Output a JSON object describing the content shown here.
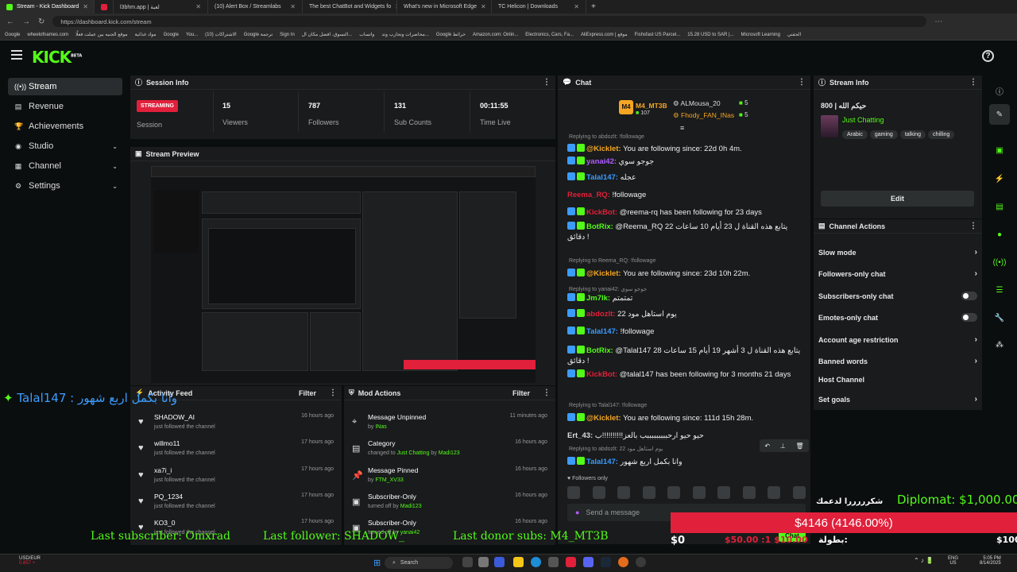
{
  "browser": {
    "tabs": [
      {
        "label": "Stream - Kick Dashboard",
        "active": true
      },
      {
        "label": ""
      },
      {
        "label": "l3bhm.app | لعبة"
      },
      {
        "label": "(10) Alert Box / Streamlabs"
      },
      {
        "label": "The best ChatBot and Widgets fo"
      },
      {
        "label": "What's new in Microsoft Edge"
      },
      {
        "label": "TC Helicon | Downloads"
      }
    ],
    "url": "https://dashboard.kick.com/stream",
    "bookmarks": [
      "Google",
      "wheelofnames.com",
      "موقع الجنيه بين عملت فعلًا",
      "مواد غذائية",
      "Google",
      "You...",
      "(10) الاشتراكات",
      "Google ترجمة",
      "Sign In",
      "التسوق، افضل مكان ال...",
      "واتساب",
      "محاضرات وتجارب وتد...",
      "Google خرائط",
      "Amazon.com: Onlin...",
      "Electronics, Cars, Fa...",
      "AliExpress.com | موقع",
      "Fishsfast US Parcel...",
      "15.28 USD to SAR |...",
      "Microsoft Learning",
      "الحقني"
    ]
  },
  "header": {
    "logo": "KICK",
    "logo_sup": "BETA"
  },
  "sidebar": [
    {
      "label": "Stream",
      "icon": "broadcast-icon",
      "active": true
    },
    {
      "label": "Revenue",
      "icon": "revenue-icon"
    },
    {
      "label": "Achievements",
      "icon": "trophy-icon"
    },
    {
      "label": "Studio",
      "icon": "studio-icon",
      "chevron": true
    },
    {
      "label": "Channel",
      "icon": "channel-icon",
      "chevron": true
    },
    {
      "label": "Settings",
      "icon": "gear-icon",
      "chevron": true
    }
  ],
  "session": {
    "title": "Session Info",
    "badge": "STREAMING",
    "badge_label": "Session",
    "stats": [
      {
        "value": "15",
        "label": "Viewers"
      },
      {
        "value": "787",
        "label": "Followers"
      },
      {
        "value": "131",
        "label": "Sub Counts"
      },
      {
        "value": "00:11:55",
        "label": "Time Live"
      }
    ]
  },
  "preview": {
    "title": "Stream Preview"
  },
  "activity": {
    "title": "Activity Feed",
    "filter": "Filter",
    "rows": [
      {
        "name": "SHADOW_AI",
        "desc": "just followed the channel",
        "time": "16 hours ago"
      },
      {
        "name": "willmo11",
        "desc": "just followed the channel",
        "time": "17 hours ago"
      },
      {
        "name": "xa7i_i",
        "desc": "just followed the channel",
        "time": "17 hours ago"
      },
      {
        "name": "PQ_1234",
        "desc": "just followed the channel",
        "time": "17 hours ago"
      },
      {
        "name": "KO3_0",
        "desc": "just followed the channel",
        "time": "17 hours ago"
      }
    ]
  },
  "mod": {
    "title": "Mod Actions",
    "filter": "Filter",
    "rows": [
      {
        "title": "Message Unpinned",
        "by": "by",
        "who": "INas",
        "time": "11 minutes ago",
        "icon": "unpin-icon"
      },
      {
        "title": "Category",
        "by": "changed to",
        "who": "Just Chatting",
        "by2": "by",
        "who2": "Madi123",
        "time": "16 hours ago",
        "icon": "category-icon"
      },
      {
        "title": "Message Pinned",
        "by": "by",
        "who": "FTM_XV33",
        "time": "16 hours ago",
        "icon": "pin-icon"
      },
      {
        "title": "Subscriber-Only",
        "by": "turned off by",
        "who": "Madi123",
        "time": "16 hours ago",
        "icon": "subscriber-icon"
      },
      {
        "title": "Subscriber-Only",
        "by": "turned off by",
        "who": "yanai42",
        "time": "16 hours ago",
        "icon": "subscriber-icon"
      }
    ]
  },
  "chat": {
    "title": "Chat",
    "top": [
      {
        "rank": "M4",
        "name": "M4_MT3B",
        "count": "107"
      },
      {
        "name": "ALMousa_20",
        "count": "5"
      },
      {
        "name": "Fhody_FAN_INas",
        "count": "5"
      }
    ],
    "messages": [
      {
        "reply": "Replying to abdozlt: !followage"
      },
      {
        "name": "@Kicklet:",
        "color": "#f5a623",
        "text": "You are following since: 22d 0h 4m."
      },
      {
        "name": "yanai42:",
        "color": "#b05cff",
        "text": "جوجو سوي"
      },
      {
        "name": "Talal147:",
        "color": "#3b9cff",
        "text": "عجله"
      },
      {
        "name": "Reema_RQ:",
        "color": "#e1203b",
        "text": "!followage"
      },
      {
        "name": "KickBot:",
        "color": "#e1203b",
        "text": "@reema-rq has been following for 23 days"
      },
      {
        "name": "BotRix:",
        "color": "#53fc18",
        "text": "@Reema_RQ يتابع هذه القناة ل 23 أيام 10 ساعات 22 دقائق !"
      },
      {
        "reply": "Replying to Reema_RQ: !followage"
      },
      {
        "name": "@Kicklet:",
        "color": "#f5a623",
        "text": "You are following since: 23d 10h 22m."
      },
      {
        "reply": "Replying to yanai42: جوجو سوي"
      },
      {
        "name": "Jm7lk:",
        "color": "#53fc18",
        "text": "تمتمتم"
      },
      {
        "name": "abdozlt:",
        "color": "#e1203b",
        "text": "يوم استاهل مود 22"
      },
      {
        "name": "Talal147:",
        "color": "#3b9cff",
        "text": "!followage"
      },
      {
        "name": "BotRix:",
        "color": "#53fc18",
        "text": "@Talal147 يتابع هذه القناة ل 3 أشهر 19 أيام 15 ساعات 28 دقائق !"
      },
      {
        "name": "KickBot:",
        "color": "#e1203b",
        "text": "@talal147 has been following for 3 months 21 days"
      },
      {
        "reply": "Replying to Talal147: !followage"
      },
      {
        "name": "@Kicklet:",
        "color": "#f5a623",
        "text": "You are following since: 111d 15h 28m."
      },
      {
        "name": "Ert_43:",
        "color": "#ddd",
        "text": "حيو حيو ارحبببببببببب بالعز!!!!!!!!!!ب"
      },
      {
        "reply": "Replying to abdozlt: يوم استاهل مود 22"
      },
      {
        "name": "Talal147:",
        "color": "#3b9cff",
        "text": "وانا بكمل اربع شهور"
      }
    ],
    "followers_only": "Followers only",
    "input_placeholder": "Send a message",
    "chat_btn": "Chat"
  },
  "stream_info": {
    "title": "Stream Info",
    "stream_title": "حيكم الله | 800",
    "category": "Just Chatting",
    "tags": [
      "Arabic",
      "gaming",
      "talking",
      "chilling"
    ],
    "edit": "Edit"
  },
  "channel_actions": {
    "title": "Channel Actions",
    "items": [
      {
        "label": "Slow mode",
        "type": "chev"
      },
      {
        "label": "Followers-only chat",
        "type": "chev"
      },
      {
        "label": "Subscribers-only chat",
        "type": "toggle"
      },
      {
        "label": "Emotes-only chat",
        "type": "toggle"
      },
      {
        "label": "Account age restriction",
        "type": "chev"
      },
      {
        "label": "Banned words",
        "type": "chev"
      },
      {
        "label": "Host Channel",
        "type": "none"
      },
      {
        "label": "Set goals",
        "type": "chev"
      }
    ]
  },
  "overlay": {
    "left_chat": "Talal147 : وانا بكمل اربع شهور",
    "diplomat": "Diplomat: $1,000.00",
    "thanks": "شكرررررا لدعمك",
    "donation_bar": "$4146 (4146.00%)",
    "zero": "$0",
    "hundred": "$100",
    "goal_label": "بطولة:",
    "goal_values": "$50.00 :1  $10.00",
    "last_sub": "Last subscriber: Omxrad",
    "last_follower": "Last follower: SHADOW_",
    "last_donor": "Last donor subs: M4_MT3B"
  },
  "taskbar": {
    "weather": "USD/EUR",
    "weather_val": "0.857 +",
    "search": "Search",
    "lang": "ENG",
    "lang2": "US",
    "time": "5:05 PM",
    "date": "8/14/2025"
  },
  "colors": {
    "kick_green": "#53fc18",
    "live_red": "#e1203b",
    "panel": "#191b1c",
    "bg": "#0b0e0f"
  }
}
